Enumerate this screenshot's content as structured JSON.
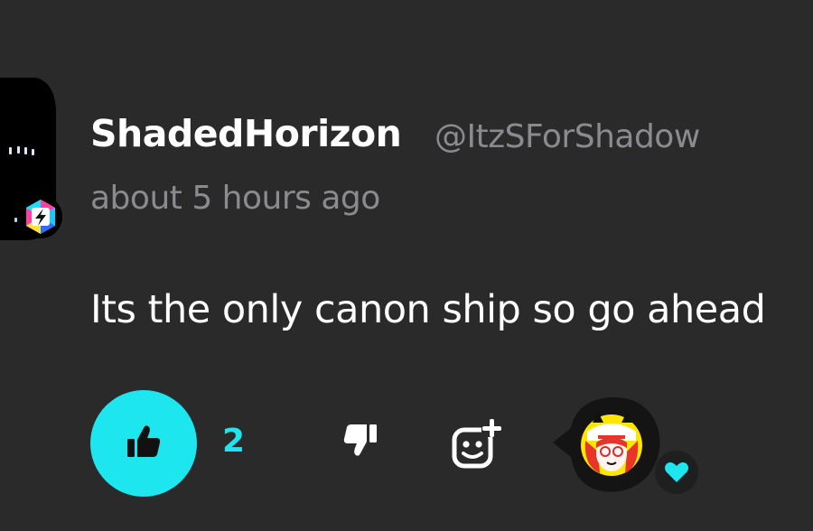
{
  "comment": {
    "username": "ShadedHorizon",
    "handle": "@ItzSForShadow",
    "timestamp": "about 5 hours ago",
    "text": "Its the only canon ship so go ahead"
  },
  "actions": {
    "like_count": "2"
  },
  "icons": {
    "avatar": "user-avatar",
    "badge": "lightning-hexagon-icon",
    "like": "thumbs-up-icon",
    "dislike": "thumbs-down-icon",
    "react": "add-reaction-icon",
    "reactor_avatar": "reactor-avatar",
    "heart": "heart-icon"
  },
  "colors": {
    "background": "#2b2a2b",
    "accent": "#1ee6ee",
    "muted_text": "#8a8a8f",
    "primary_text": "#ffffff"
  }
}
